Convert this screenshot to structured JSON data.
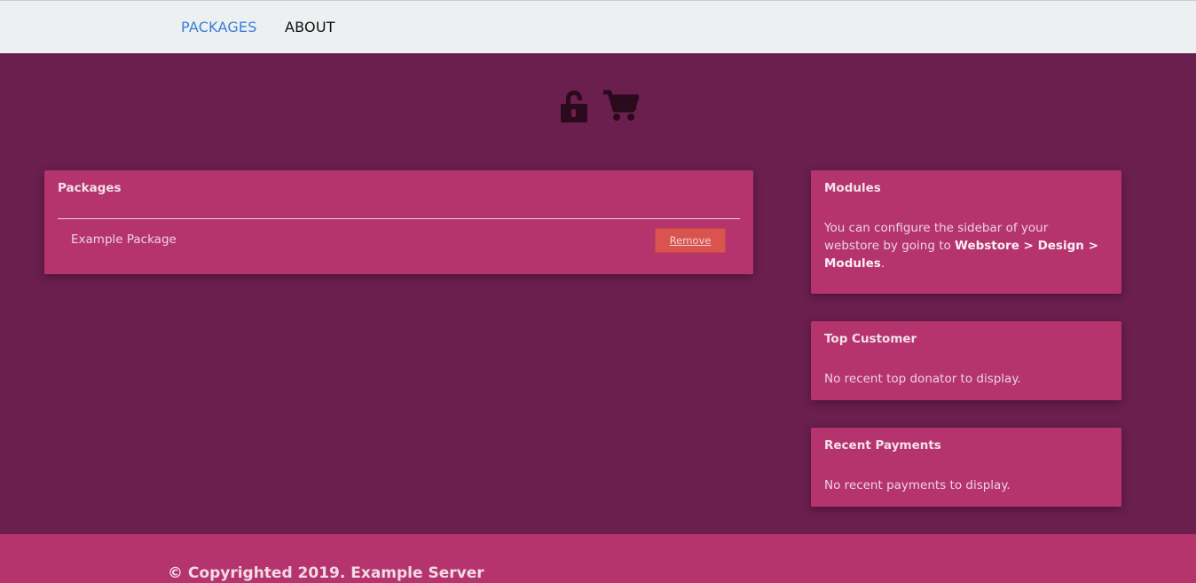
{
  "nav": {
    "items": [
      {
        "label": "PACKAGES",
        "active": true
      },
      {
        "label": "ABOUT",
        "active": false
      }
    ]
  },
  "icons": {
    "login": "unlock-icon",
    "cart": "shopping-cart-icon"
  },
  "packages_panel": {
    "title": "Packages",
    "items": [
      {
        "name": "Example Package",
        "remove_label": "Remove"
      }
    ]
  },
  "sidebar": {
    "modules": {
      "title": "Modules",
      "text_before": "You can configure the sidebar of your webstore by going to ",
      "path": "Webstore > Design > Modules",
      "text_after": "."
    },
    "top_customer": {
      "title": "Top Customer",
      "text": "No recent top donator to display."
    },
    "recent_payments": {
      "title": "Recent Payments",
      "text": "No recent payments to display."
    }
  },
  "footer": {
    "text": "© Copyrighted 2019. Example Server"
  },
  "colors": {
    "background": "#6b1f4f",
    "panel": "#b5346e",
    "nav": "#ecf0f1",
    "nav_active": "#3b7dd8",
    "remove_button": "#d9534f"
  }
}
